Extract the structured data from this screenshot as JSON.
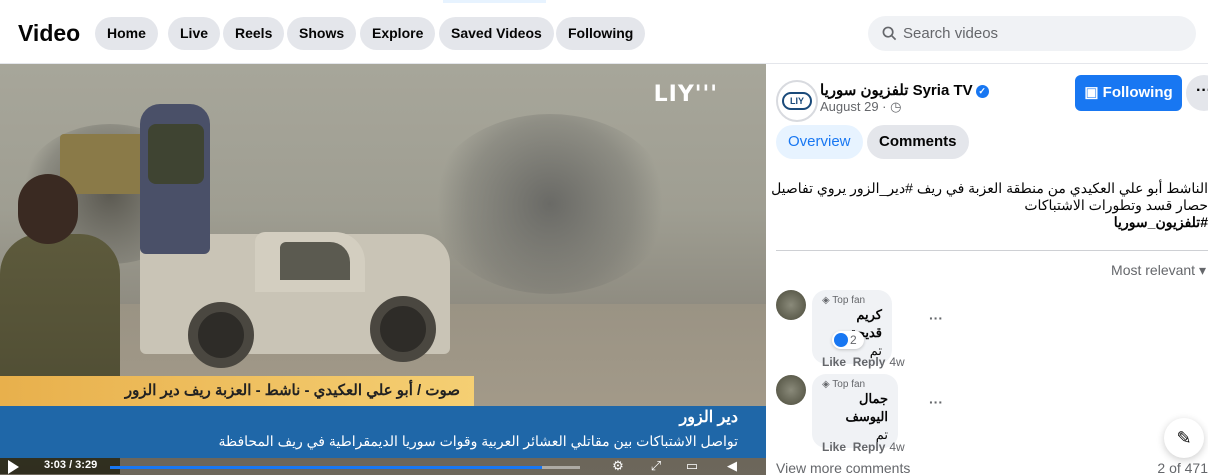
{
  "header": {
    "title": "Video",
    "nav": [
      "Home",
      "Live",
      "Reels",
      "Shows",
      "Explore",
      "Saved Videos",
      "Following"
    ],
    "search_placeholder": "Search videos"
  },
  "video": {
    "watermark": "LIY'''",
    "lower_third_yellow": "صوت / أبو علي العكيدي - ناشط - العزبة ريف دير الزور",
    "lower_third_title": "دير الزور",
    "lower_third_sub": "تواصل الاشتباكات بين مقاتلي العشائر العربية وقوات سوريا الديمقراطية في ريف المحافظة",
    "time": "3:03 / 3:29",
    "progress": 0.92
  },
  "post": {
    "page_name": "تلفزيون سوريا Syria TV",
    "date": "August 29 · ",
    "follow_label": "Following",
    "more_label": "···",
    "tabs": [
      "Overview",
      "Comments"
    ],
    "description_line1": "الناشط أبو علي العكيدي من منطقة العزبة في ريف #دير_الزور يروي تفاصيل",
    "description_line2": "حصار قسد وتطورات الاشتباكات",
    "description_line3": "#تلفزيون_سوريا"
  },
  "comments": {
    "sort_label": "Most relevant",
    "items": [
      {
        "badge": "Top fan",
        "name": "كريم قديحة",
        "text": "تم",
        "reaction_count": "2",
        "like": "Like",
        "reply": "Reply",
        "ago": "4w",
        "more": "···"
      },
      {
        "badge": "Top fan",
        "name": "جمال اليوسف",
        "text": "تم",
        "like": "Like",
        "reply": "Reply",
        "ago": "4w",
        "more": "···"
      }
    ],
    "view_more": "View more comments",
    "counter": "2 of 471"
  },
  "colors": {
    "accent": "#1877f2",
    "banner_blue": "#1f67a8",
    "banner_yellow": "#f5cf73"
  }
}
